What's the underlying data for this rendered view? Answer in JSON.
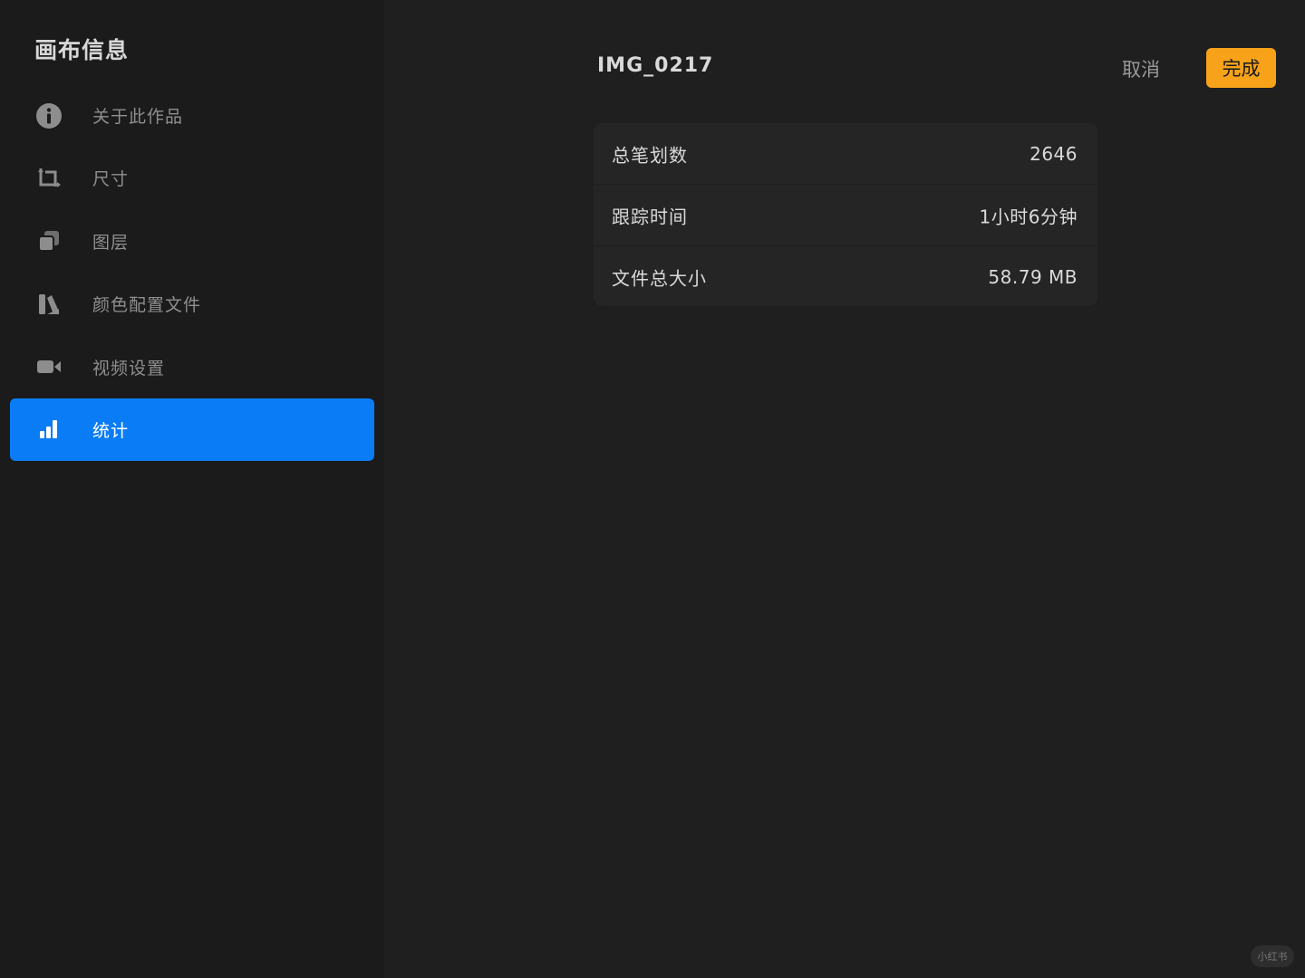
{
  "sidebar": {
    "title": "画布信息",
    "items": [
      {
        "label": "关于此作品",
        "icon": "info-icon"
      },
      {
        "label": "尺寸",
        "icon": "crop-icon"
      },
      {
        "label": "图层",
        "icon": "layers-icon"
      },
      {
        "label": "颜色配置文件",
        "icon": "color-profile-icon"
      },
      {
        "label": "视频设置",
        "icon": "video-camera-icon"
      },
      {
        "label": "统计",
        "icon": "bar-chart-icon",
        "active": true
      }
    ]
  },
  "header": {
    "title": "IMG_0217",
    "cancel_label": "取消",
    "done_label": "完成"
  },
  "stats": [
    {
      "label": "总笔划数",
      "value": "2646"
    },
    {
      "label": "跟踪时间",
      "value": "1小时6分钟"
    },
    {
      "label": "文件总大小",
      "value": "58.79 MB"
    }
  ],
  "watermark": "小红书",
  "colors": {
    "accent_blue": "#0a7cf6",
    "done_orange": "#f7a219",
    "background": "#1e1e1e",
    "sidebar": "#1b1b1b"
  }
}
